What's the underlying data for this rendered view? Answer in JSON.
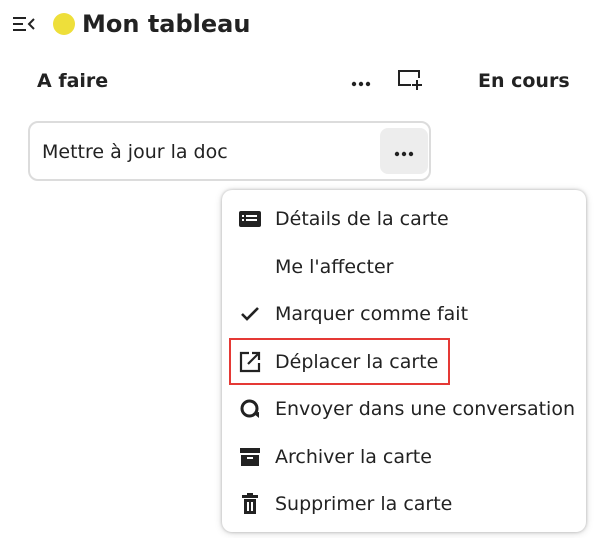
{
  "header": {
    "menu_icon": "menu-collapse-icon",
    "board_title": "Mon tableau",
    "board_color": "#EEDF3A"
  },
  "columns": [
    {
      "title": "A faire"
    },
    {
      "title": "En cours"
    }
  ],
  "column_actions": {
    "more_icon": "more-horizontal-icon",
    "add_card_icon": "add-card-icon"
  },
  "card": {
    "title": "Mettre à jour la doc",
    "more_icon": "more-horizontal-icon"
  },
  "card_menu": {
    "items": [
      {
        "label": "Détails de la carte",
        "icon": "card-details-icon"
      },
      {
        "label": "Me l'affecter",
        "icon": ""
      },
      {
        "label": "Marquer comme fait",
        "icon": "check-icon"
      },
      {
        "label": "Déplacer la carte",
        "icon": "open-in-new-icon"
      },
      {
        "label": "Envoyer dans une conversation",
        "icon": "talk-icon"
      },
      {
        "label": "Archiver la carte",
        "icon": "archive-icon"
      },
      {
        "label": "Supprimer la carte",
        "icon": "delete-icon"
      }
    ],
    "highlighted_index": 3
  },
  "colors": {
    "highlight": "#E53935",
    "text": "#222222",
    "card_border": "#DCDCDC",
    "button_bg": "#EDEDED"
  }
}
